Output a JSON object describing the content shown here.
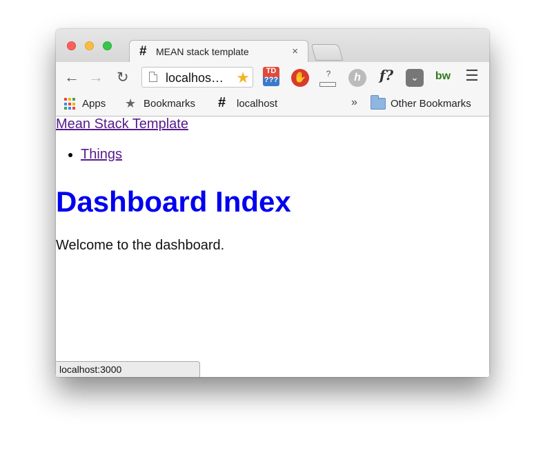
{
  "tab": {
    "icon": "hash-icon",
    "title": "MEAN stack template",
    "close": "×"
  },
  "toolbar": {
    "back": "←",
    "forward": "→",
    "reload": "↻",
    "url": "localhos…",
    "star": "★",
    "ext_td": "TD\n???",
    "ext_stop": "✋",
    "ext_q": "?",
    "ext_h": "h",
    "ext_f": "f?",
    "ext_pocket": "⌄",
    "ext_bw": "bw",
    "menu": "☰"
  },
  "bookmarks": {
    "apps": "Apps",
    "bookmarks": "Bookmarks",
    "localhost": "localhost",
    "more": "»",
    "other": "Other Bookmarks",
    "apps_colors": [
      "#e9463b",
      "#f0b40f",
      "#3aa757",
      "#4a86e8",
      "#e9463b",
      "#f0b40f",
      "#3aa757",
      "#4a86e8",
      "#e9463b"
    ]
  },
  "page": {
    "brand": "Mean Stack Template",
    "nav": [
      "Things"
    ],
    "heading": "Dashboard Index",
    "welcome": "Welcome to the dashboard."
  },
  "status": {
    "text": "localhost:3000"
  }
}
